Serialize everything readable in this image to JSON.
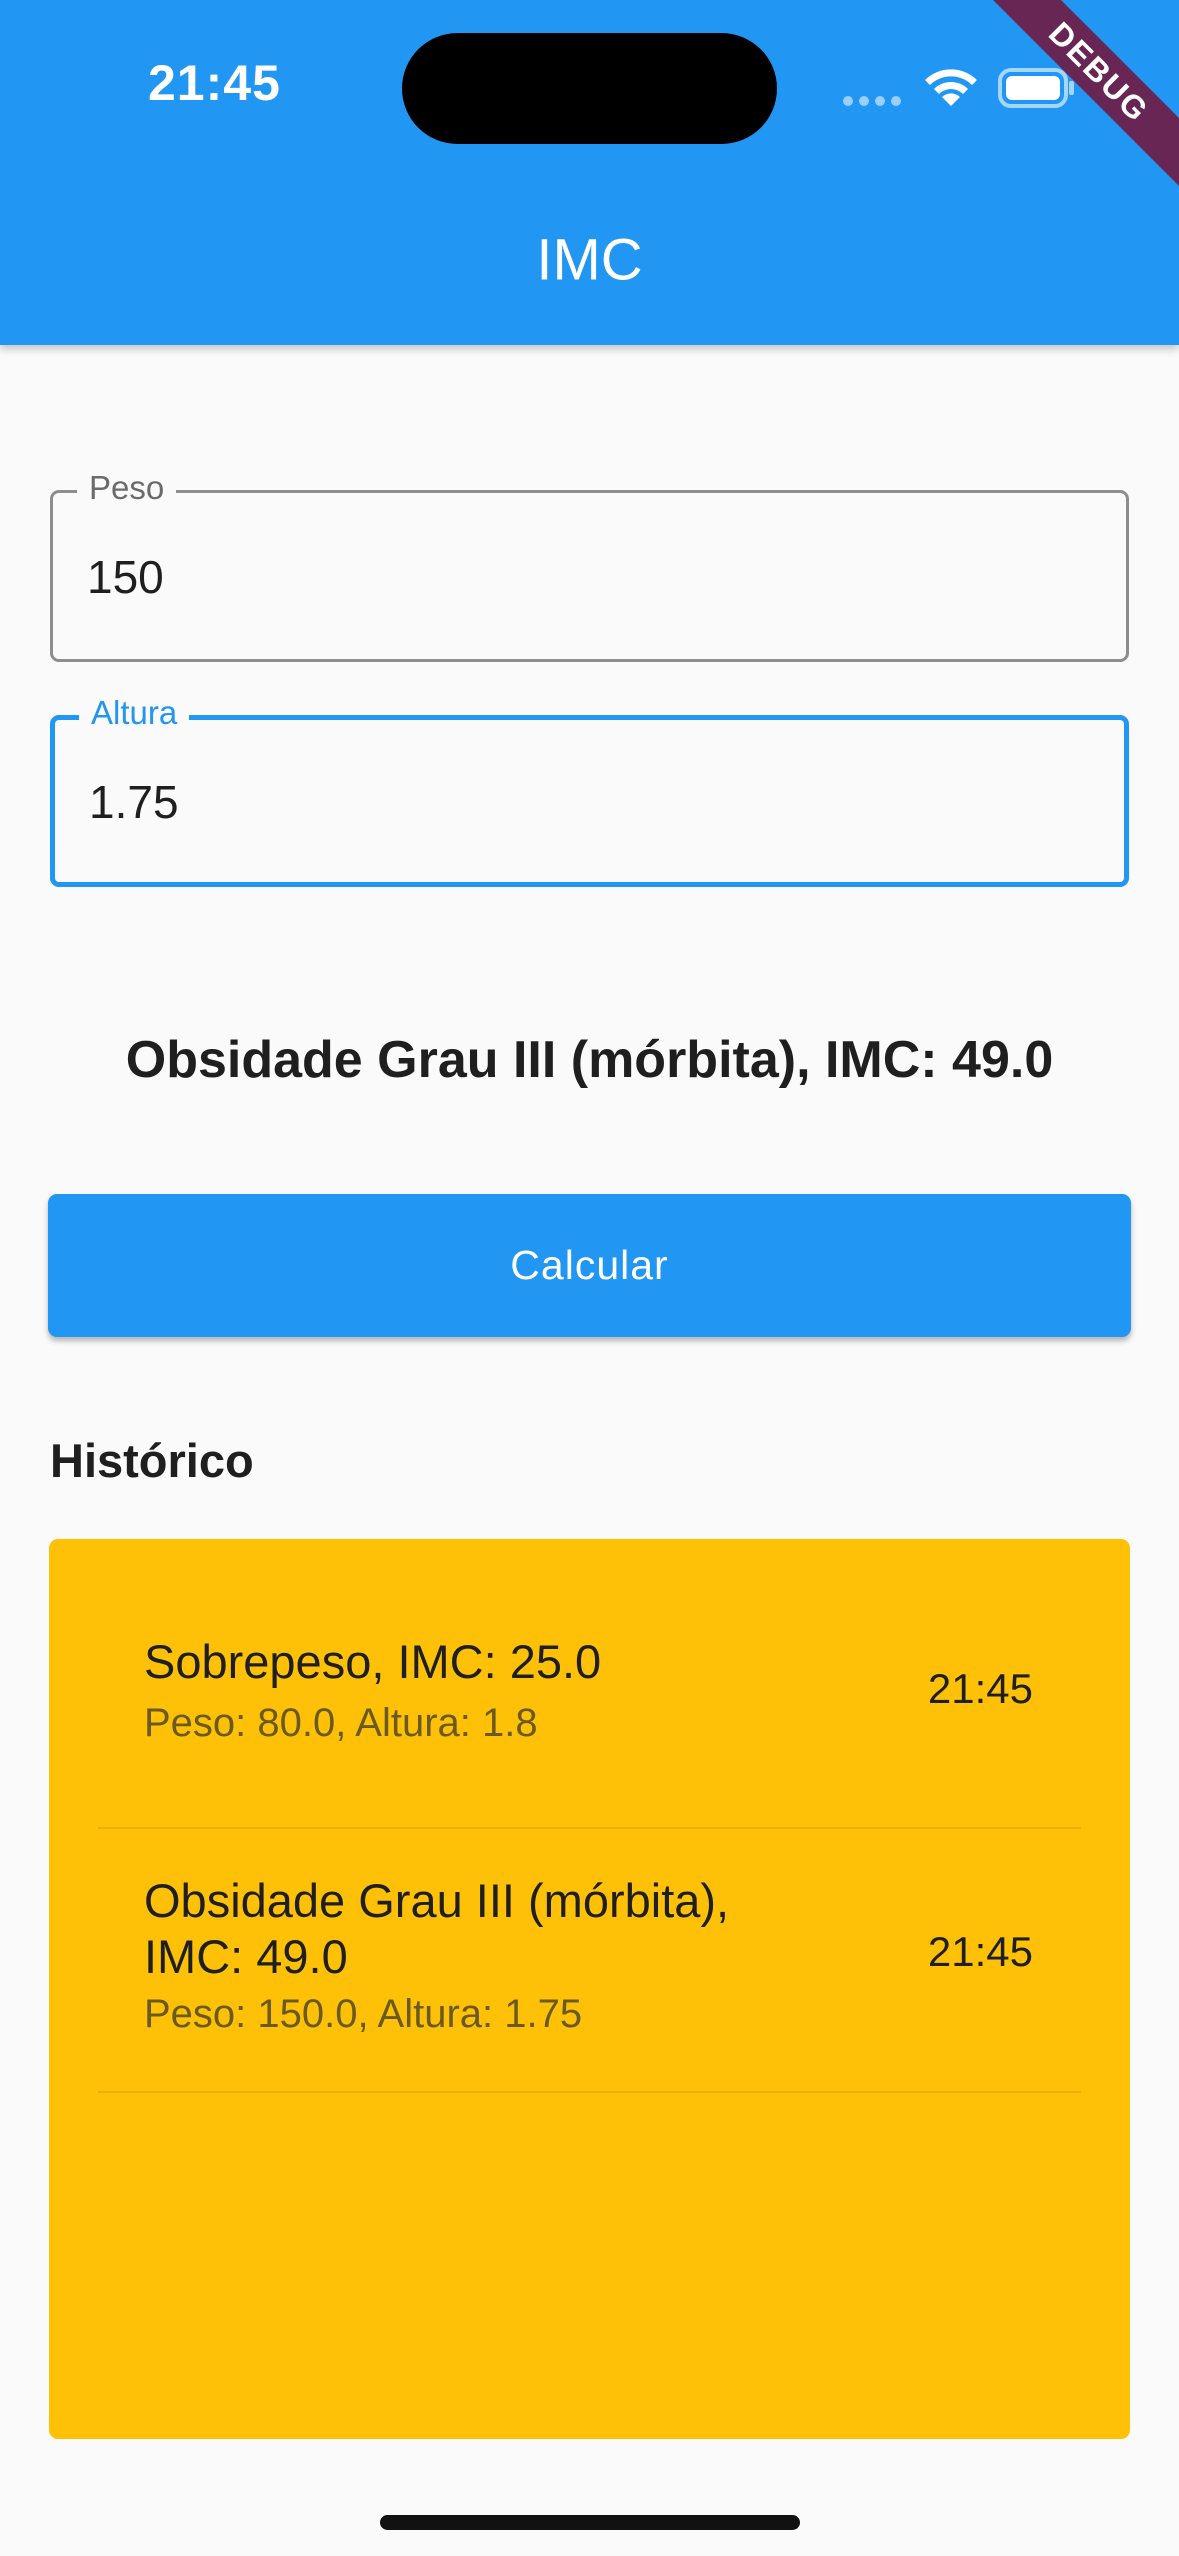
{
  "status_bar": {
    "time": "21:45",
    "icons": [
      "signal-icon",
      "wifi-icon",
      "battery-icon"
    ]
  },
  "debug_banner": "DEBUG",
  "app_bar": {
    "title": "IMC"
  },
  "form": {
    "peso": {
      "label": "Peso",
      "value": "150"
    },
    "altura": {
      "label": "Altura",
      "value": "1.75"
    }
  },
  "result": {
    "text": "Obsidade Grau III (mórbita), IMC: 49.0"
  },
  "calculate_button": {
    "label": "Calcular"
  },
  "history": {
    "title": "Histórico",
    "items": [
      {
        "title": "Sobrepeso, IMC: 25.0",
        "subtitle": "Peso: 80.0, Altura: 1.8",
        "time": "21:45"
      },
      {
        "title": "Obsidade Grau III (mórbita), IMC: 49.0",
        "subtitle": "Peso: 150.0, Altura: 1.75",
        "time": "21:45"
      }
    ]
  },
  "colors": {
    "primary": "#2196f3",
    "history_background": "#ffc107",
    "background": "#fafafa",
    "debug_banner": "#800020"
  }
}
